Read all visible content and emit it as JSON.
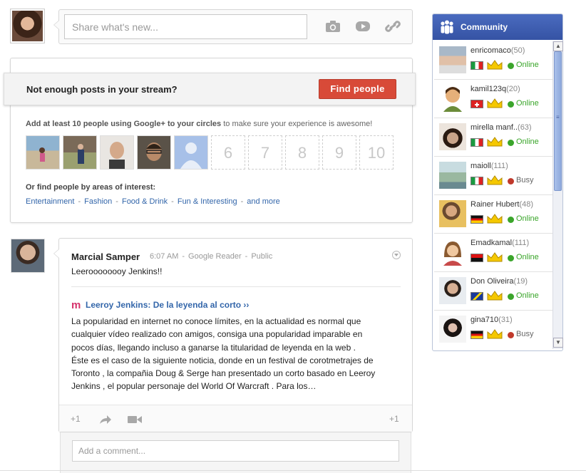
{
  "share": {
    "placeholder": "Share what's new...",
    "icons": [
      "camera-icon",
      "video-icon",
      "link-icon"
    ]
  },
  "notice": {
    "title": "Not enough posts in your stream?",
    "find_button": "Find people",
    "add_bold": "Add at least 10 people using Google+ to your circles",
    "add_rest": "to make sure your experience is awesome!",
    "empty_slots": [
      "6",
      "7",
      "8",
      "9",
      "10"
    ],
    "interest_label": "Or find people by areas of interest:",
    "interests": [
      "Entertainment",
      "Fashion",
      "Food & Drink",
      "Fun & Interesting",
      "and more"
    ]
  },
  "post": {
    "author": "Marcial Samper",
    "time": "6:07 AM",
    "source": "Google Reader",
    "visibility": "Public",
    "body": "Leeroooooooy Jenkins!!",
    "link_title": "Leeroy Jenkins: De la leyenda al corto ››",
    "excerpt_lines": [
      "La popularidad en internet no conoce límites, en la actualidad es normal que",
      "cualquier vídeo realizado con amigos, consiga una popularidad imparable en",
      "pocos días, llegando incluso a ganarse la titularidad de leyenda en la web .",
      "Éste es el caso de la siguiente noticia, donde en un festival de corotmetrajes de",
      "Toronto , la compañia Doug & Serge han presentado un corto basado en Leeroy",
      "Jenkins , el popular personaje del World Of Warcraft . Para los…"
    ],
    "plus_one_label": "+1",
    "plus_count": "+1",
    "comment_placeholder": "Add a comment..."
  },
  "community": {
    "title": "Community",
    "colors": {
      "online": "#3aa52a",
      "busy": "#c0392b",
      "header": "#3d5db0"
    },
    "members": [
      {
        "name": "enricomaco",
        "count": "(50)",
        "flag": "italy",
        "status": "Online"
      },
      {
        "name": "kamil123q",
        "count": "(20)",
        "flag": "switzerland",
        "status": "Online"
      },
      {
        "name": "mirella manf..",
        "count": "(63)",
        "flag": "italy",
        "status": "Online"
      },
      {
        "name": "maioll",
        "count": "(111)",
        "flag": "italy",
        "status": "Busy"
      },
      {
        "name": "Rainer Hubert",
        "count": "(48)",
        "flag": "germany",
        "status": "Online"
      },
      {
        "name": "Emadkamal",
        "count": "(111)",
        "flag": "angola",
        "status": "Online"
      },
      {
        "name": "Don Oliveira",
        "count": "(19)",
        "flag": "bosnia",
        "status": "Online"
      },
      {
        "name": "gina710",
        "count": "(31)",
        "flag": "germany",
        "status": "Busy"
      }
    ]
  }
}
